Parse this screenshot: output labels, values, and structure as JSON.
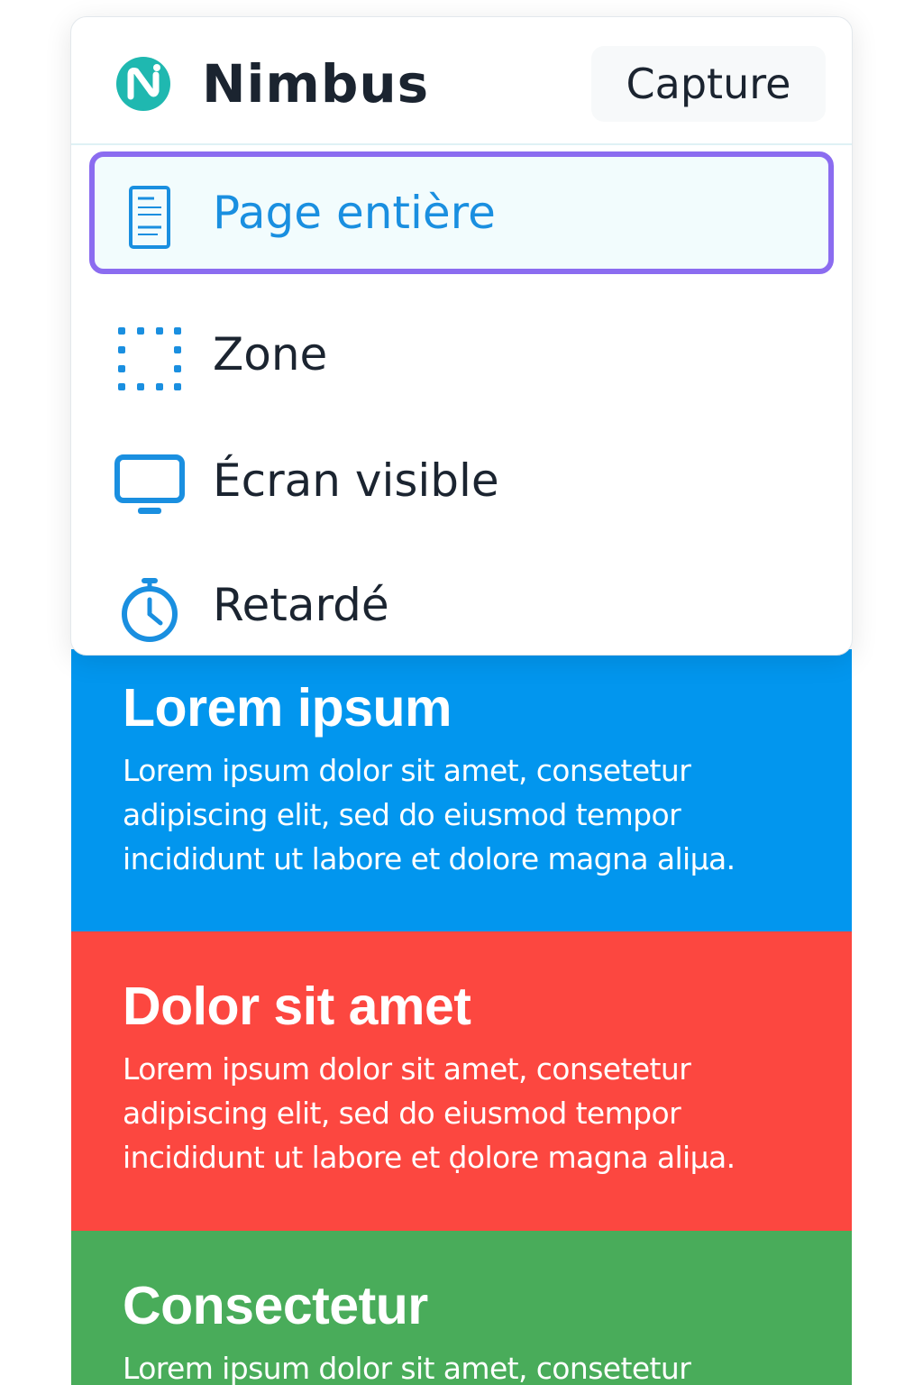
{
  "header": {
    "app_name": "Nimbus",
    "capture_label": "Capture"
  },
  "menu": {
    "items": [
      {
        "label": "Page entière",
        "icon": "full-page-icon",
        "selected": true
      },
      {
        "label": "Zone",
        "icon": "selection-area-icon",
        "selected": false
      },
      {
        "label": "Écran visible",
        "icon": "monitor-icon",
        "selected": false
      },
      {
        "label": "Retardé",
        "icon": "timer-icon",
        "selected": false
      }
    ]
  },
  "page": {
    "sections": [
      {
        "title": "Lorem ipsum",
        "lines": [
          "Lorem ipsum dolor sit amet, consetetur",
          "adipiscing elit, sed do eiusmod tempor",
          "incididunt ut labore et dolore magna aliµa."
        ]
      },
      {
        "title": "Dolor sit amet",
        "lines": [
          "Lorem ipsum dolor sit amet, consetetur",
          "adipiscing elit, sed do eiusmod tempor",
          "incididunt ut labore et ḍolore magna aliµa."
        ]
      },
      {
        "title": "Consectetur",
        "lines": [
          "Lorem ipsum dolor sit amet, consetetur"
        ]
      }
    ]
  },
  "colors": {
    "accent": "#1a8fe0",
    "selection_border": "#8b6cf0",
    "section_blue": "#0296ee",
    "section_red": "#fc4740",
    "section_green": "#49ac5a",
    "logo_teal": "#1fb8b0"
  }
}
